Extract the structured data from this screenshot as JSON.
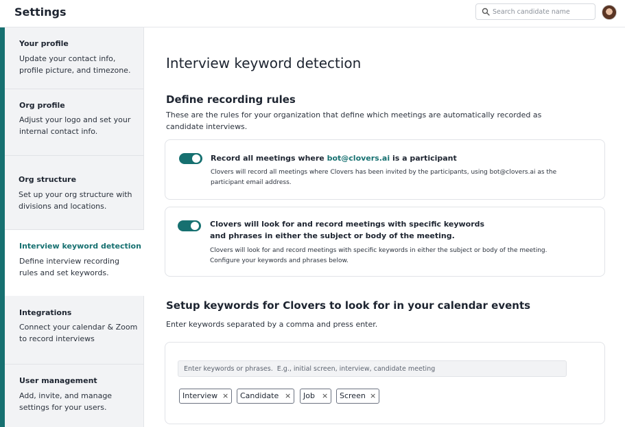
{
  "app": {
    "title": "Settings"
  },
  "search": {
    "placeholder": "Search candidate name",
    "value": ""
  },
  "sidebar": {
    "items": [
      {
        "title": "Your profile",
        "desc": "Update your contact info, profile picture, and timezone."
      },
      {
        "title": "Org profile",
        "desc": "Adjust your logo and set your internal contact info."
      },
      {
        "title": "Org structure",
        "desc": "Set up your org structure with divisions and locations."
      },
      {
        "title": "Interview keyword detection",
        "desc": "Define interview recording rules and set keywords."
      },
      {
        "title": "Integrations",
        "desc": "Connect your calendar & Zoom to record interviews"
      },
      {
        "title": "User management",
        "desc": "Add, invite, and manage settings for your users."
      }
    ],
    "active_item": "Interview keyword detection"
  },
  "main": {
    "title": "Interview keyword detection",
    "rules_heading": "Define recording rules",
    "rules_desc": "These are the rules for your organization that define which meetings are automatically recorded as candidate interviews.",
    "rules": [
      {
        "enabled": true,
        "title_prefix": "Record all meetings where ",
        "title_highlight": "bot@clovers.ai",
        "title_suffix": " is a participant",
        "desc": "Clovers will record all meetings where Clovers has been invited by the participants, using bot@clovers.ai as the participant email address."
      },
      {
        "enabled": true,
        "title": "Clovers will look for and record meetings with specific keywords and phrases in either the subject or body of the meeting.",
        "desc": "Clovers will look for and record meetings with specific keywords in either the subject or body of the meeting.  Configure your keywords and phrases below."
      }
    ],
    "keywords_heading": "Setup keywords for Clovers to look for in your calendar events",
    "keywords_desc": "Enter keywords separated by a comma and press enter.",
    "keywords_input": {
      "placeholder": "Enter keywords or phrases.  E.g., initial screen, interview, candidate meeting",
      "value": ""
    },
    "keywords": [
      "Interview",
      "Candidate",
      "Job",
      "Screen"
    ],
    "chip_remove_glyph": "×"
  },
  "colors": {
    "accent": "#167070",
    "sidebar_bg": "#f2f3f5",
    "text": "#1d2430"
  }
}
